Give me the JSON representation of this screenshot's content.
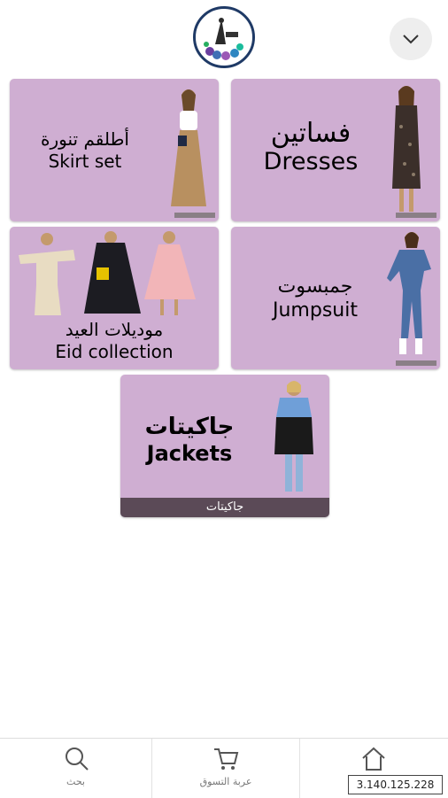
{
  "header": {
    "logo_icon": "brand-logo",
    "menu_icon": "chevron-down-icon"
  },
  "categories": [
    {
      "ar": "أطلقم تنورة",
      "en": "Skirt set"
    },
    {
      "ar": "فساتين",
      "en": "Dresses"
    },
    {
      "ar": "موديلات العيد",
      "en": "Eid collection"
    },
    {
      "ar": "جمبسوت",
      "en": "Jumpsuit"
    },
    {
      "ar": "جاكيتات",
      "en": "Jackets",
      "caption": "جاكيتات"
    }
  ],
  "nav": {
    "search_label": "بحث",
    "cart_label": "عربة التسوق",
    "home_label": ""
  },
  "ip_label": "3.140.125.228",
  "colors": {
    "card_bg": "#cfaed2",
    "caption_bg": "#5b4a57",
    "logo_ring": "#1f3a66"
  }
}
